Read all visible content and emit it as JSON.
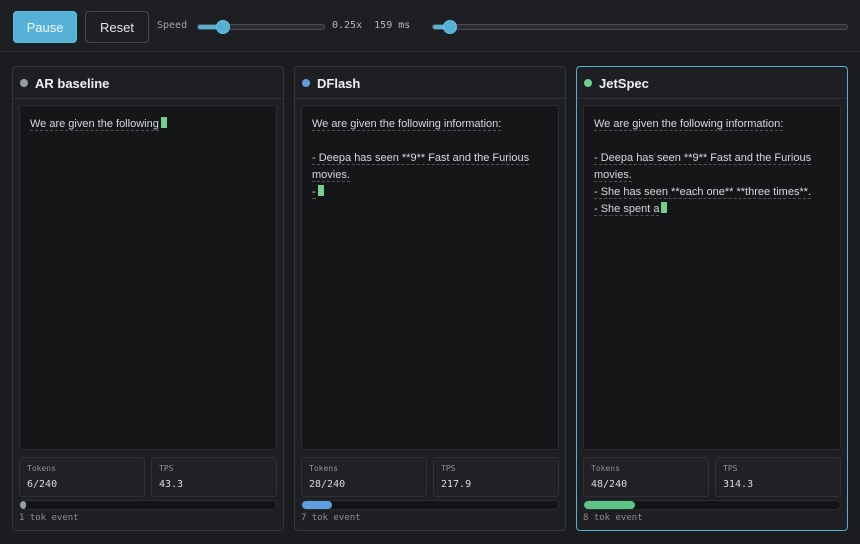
{
  "controls": {
    "pause_label": "Pause",
    "reset_label": "Reset",
    "speed_label": "Speed",
    "speed_value": "0.25x",
    "delay_value": "159 ms",
    "speed_level": 0.2,
    "timeline_level": 0.04
  },
  "panels": [
    {
      "title": "AR baseline",
      "dot_color": "#9a9ea6",
      "bar_color": "#9a9ea6",
      "active": false,
      "lines": [
        "We are given the following"
      ],
      "tokens_label": "Tokens",
      "tokens_value": "6/240",
      "tps_label": "TPS",
      "tps_value": "43.3",
      "progress": 0.025,
      "event": "1 tok event"
    },
    {
      "title": "DFlash",
      "dot_color": "#5e9de0",
      "bar_color": "#5e9de0",
      "active": false,
      "lines": [
        "We are given the following information:",
        "",
        "- Deepa has seen **9** Fast and the Furious",
        "movies.",
        "-"
      ],
      "tokens_label": "Tokens",
      "tokens_value": "28/240",
      "tps_label": "TPS",
      "tps_value": "217.9",
      "progress": 0.117,
      "event": "7 tok event"
    },
    {
      "title": "JetSpec",
      "dot_color": "#6dd08b",
      "bar_color": "#5cc487",
      "active": true,
      "lines": [
        "We are given the following information:",
        "",
        "- Deepa has seen **9** Fast and the Furious",
        "movies.",
        "- She has seen **each one** **three times**.",
        "- She spent a"
      ],
      "tokens_label": "Tokens",
      "tokens_value": "48/240",
      "tps_label": "TPS",
      "tps_value": "314.3",
      "progress": 0.2,
      "event": "8 tok event"
    }
  ]
}
